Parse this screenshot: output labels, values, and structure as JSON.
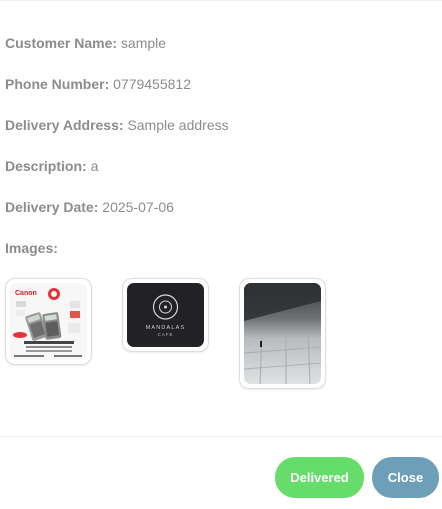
{
  "details": [
    {
      "label": "Customer Name:",
      "value": "sample"
    },
    {
      "label": "Phone Number:",
      "value": "0779455812"
    },
    {
      "label": "Delivery Address:",
      "value": "Sample address"
    },
    {
      "label": "Description:",
      "value": "a"
    },
    {
      "label": "Delivery Date:",
      "value": "2025-07-06"
    },
    {
      "label": "Images:",
      "value": ""
    }
  ],
  "images": [
    {
      "name": "canon-calculator-product-image",
      "brand_text": "Canon",
      "caption": "Canon Mini Desktop Printing Calculator"
    },
    {
      "name": "mandalas-cafe-logo-image",
      "text_line1": "MANDALAS",
      "text_line2": "CAFE"
    },
    {
      "name": "ceiling-photo-image"
    }
  ],
  "buttons": {
    "delivered": "Delivered",
    "close": "Close"
  },
  "colors": {
    "delivered": "#66dd6a",
    "close": "#6e9fb8",
    "text": "#8c8c8c"
  }
}
